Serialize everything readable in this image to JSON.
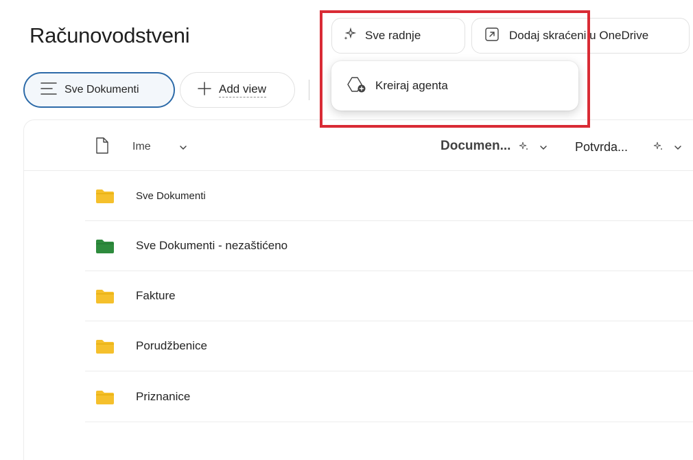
{
  "header": {
    "title": "Računovodstveni",
    "actions_button": {
      "label": "Sve radnje",
      "icon": "sparkle-icon"
    },
    "shortcut_button": {
      "label": "Dodaj skraćeni u OneDrive",
      "icon": "arrow-up-right-icon"
    }
  },
  "toolbar": {
    "view_pill": {
      "label": "Sve Dokumenti",
      "icon": "lines-icon"
    },
    "add_view": {
      "label": "Add view",
      "icon": "plus-icon"
    }
  },
  "dropdown": {
    "items": [
      {
        "label": "Kreiraj agenta",
        "icon": "create-agent-icon"
      }
    ]
  },
  "list": {
    "columns": [
      {
        "label": "Ime"
      },
      {
        "label": "Documen..."
      },
      {
        "label": "Potvrda..."
      }
    ],
    "rows": [
      {
        "name": "Sve Dokumenti",
        "folder_color": "#f5c02c"
      },
      {
        "name": "Sve Dokumenti - nezaštićeno",
        "folder_color": "#2e8b3d"
      },
      {
        "name": "Fakture",
        "folder_color": "#f5c02c"
      },
      {
        "name": "Porudžbenice",
        "folder_color": "#f5c02c"
      },
      {
        "name": "Priznanice",
        "folder_color": "#f5c02c"
      }
    ]
  },
  "colors": {
    "accent": "#2c6aa8",
    "highlight": "#d92b35"
  }
}
